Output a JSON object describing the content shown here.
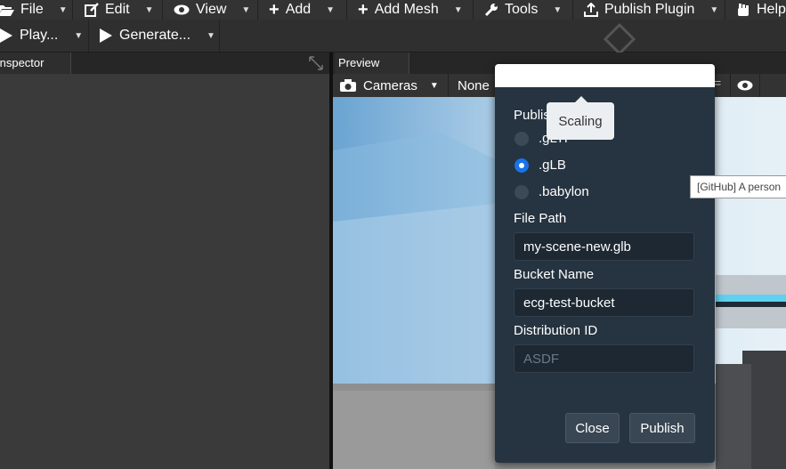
{
  "menubar": {
    "items": [
      {
        "label": "File",
        "icon": "folder-open-icon"
      },
      {
        "label": "Edit",
        "icon": "edit-icon"
      },
      {
        "label": "View",
        "icon": "eye-icon"
      },
      {
        "label": "Add",
        "icon": "plus-icon"
      },
      {
        "label": "Add Mesh",
        "icon": "plus-icon"
      },
      {
        "label": "Tools",
        "icon": "wrench-icon"
      },
      {
        "label": "Publish Plugin",
        "icon": "upload-icon"
      },
      {
        "label": "Help",
        "icon": "hand-icon"
      }
    ]
  },
  "toolbar2": {
    "play_label": "Play...",
    "generate_label": "Generate..."
  },
  "inspector": {
    "tab_label": "Inspector"
  },
  "preview": {
    "tab_label": "Preview",
    "cameras_label": "Cameras",
    "none_label": "None"
  },
  "dialog": {
    "format_heading": "Publish",
    "formats": [
      {
        "label": ".gLTF",
        "selected": false
      },
      {
        "label": ".gLB",
        "selected": true
      },
      {
        "label": ".babylon",
        "selected": false
      }
    ],
    "file_path_label": "File Path",
    "file_path_value": "my-scene-new.glb",
    "bucket_name_label": "Bucket Name",
    "bucket_name_value": "ecg-test-bucket",
    "distribution_id_label": "Distribution ID",
    "distribution_id_placeholder": "ASDF",
    "close_label": "Close",
    "publish_label": "Publish"
  },
  "tooltips": {
    "scaling": "Scaling",
    "github": "[GitHub] A person"
  },
  "colors": {
    "dialog_bg": "#263340",
    "accent": "#1a73e8",
    "sky": "#7fb0d6"
  }
}
